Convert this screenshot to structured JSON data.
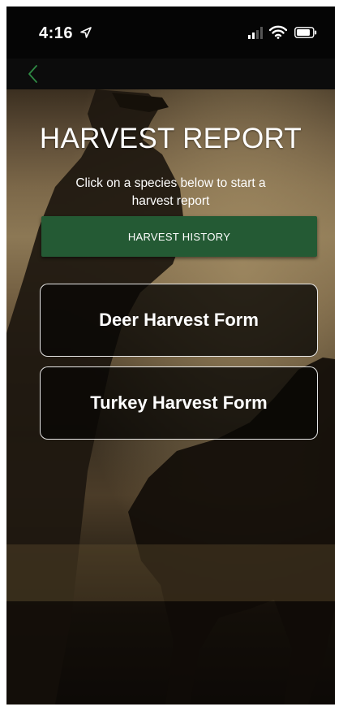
{
  "status_bar": {
    "time": "4:16",
    "location_icon": "location-arrow-icon",
    "signal_icon": "cellular-signal-icon",
    "wifi_icon": "wifi-icon",
    "battery_icon": "battery-icon"
  },
  "nav": {
    "back_icon": "chevron-left-icon",
    "accent_color": "#2f8a44"
  },
  "main": {
    "title": "HARVEST REPORT",
    "subtitle": "Click on a species below to start a harvest report",
    "history_button": "HARVEST HISTORY",
    "history_button_color": "#245a34",
    "forms": [
      {
        "label": "Deer Harvest Form"
      },
      {
        "label": "Turkey Harvest Form"
      }
    ]
  }
}
